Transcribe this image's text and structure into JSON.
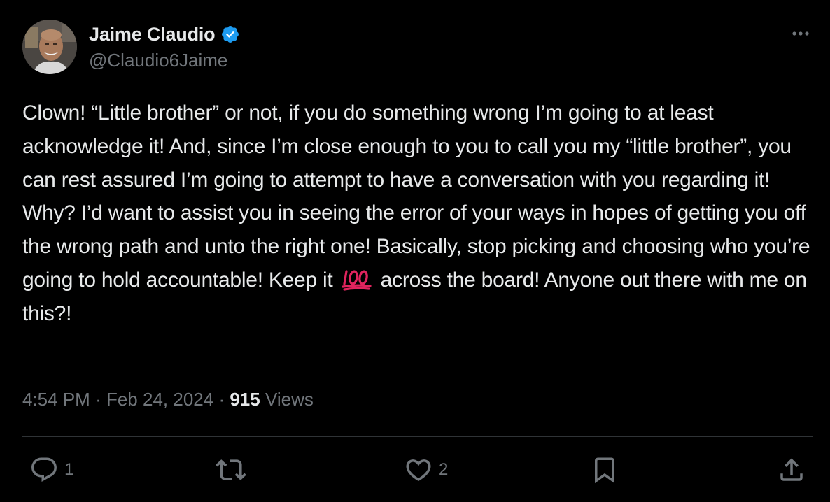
{
  "author": {
    "name": "Jaime Claudio",
    "handle": "@Claudio6Jaime",
    "verified": true
  },
  "tweet": {
    "text_before_emoji": "Clown! “Little brother” or not, if you do something wrong I’m going to at least acknowledge it! And, since I’m close enough to you to call you my “little brother”, you can rest assured I’m going to attempt to have a conversation with you regarding it! Why? I’d want to assist you in seeing the error of your ways in hopes of getting you off the wrong path and unto the right one! Basically, stop picking and choosing who you’re going to hold accountable! Keep it",
    "emoji": "100-emoji",
    "text_after_emoji": "across the board! Anyone out there with me on this?!"
  },
  "meta": {
    "time": "4:54 PM",
    "separator": "·",
    "date": "Feb 24, 2024",
    "views_count": "915",
    "views_label": "Views"
  },
  "actions": {
    "reply_count": "1",
    "retweet_count": "",
    "like_count": "2",
    "icons": [
      "reply-icon",
      "retweet-icon",
      "like-icon",
      "bookmark-icon",
      "share-icon"
    ]
  },
  "colors": {
    "background": "#000000",
    "text": "#e7e9ea",
    "secondary": "#71767b",
    "verified": "#1d9bf0",
    "divider": "#2f3336",
    "emoji_red": "#e0245e"
  }
}
